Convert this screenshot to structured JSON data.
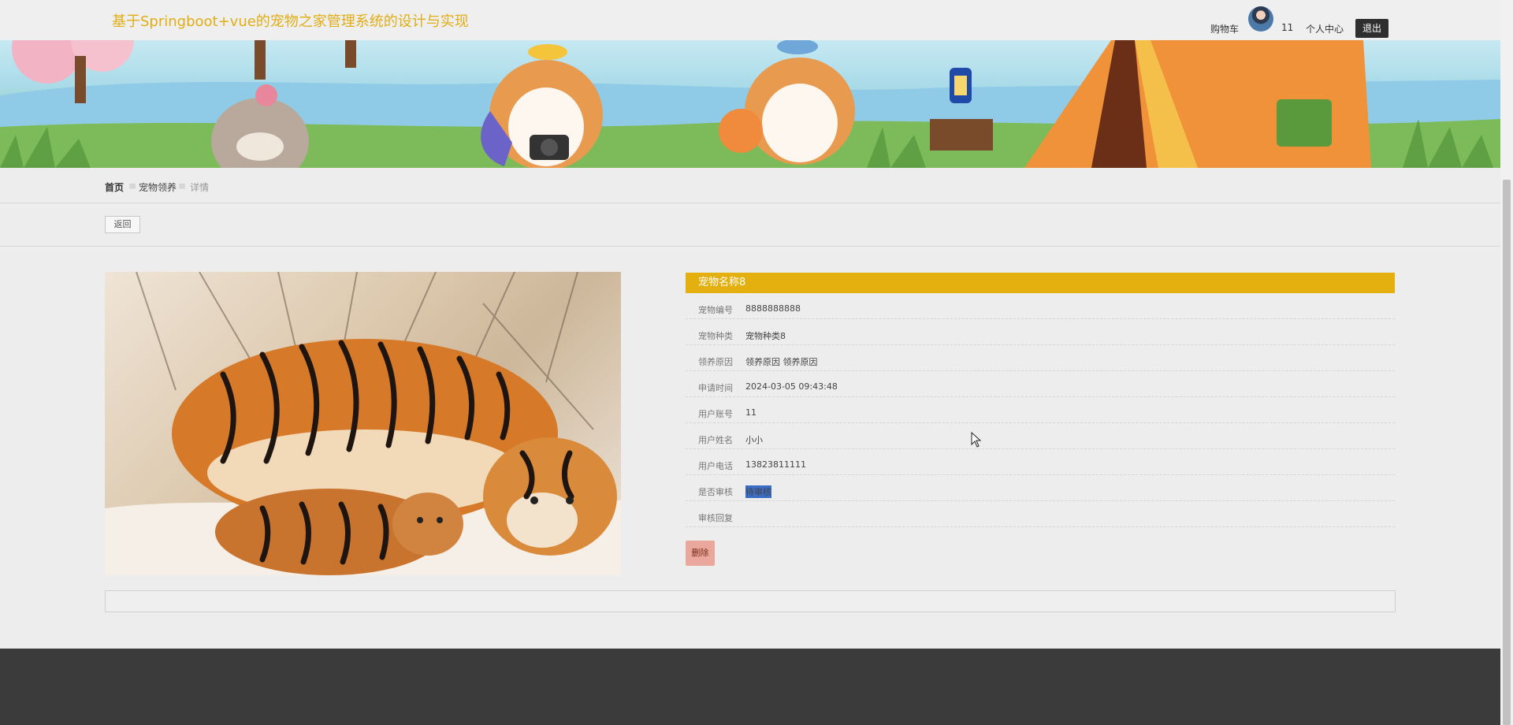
{
  "header": {
    "title": "基于Springboot+vue的宠物之家管理系统的设计与实现",
    "cart_label": "购物车",
    "user_account": "11",
    "user_center_label": "个人中心",
    "logout_label": "退出"
  },
  "breadcrumb": {
    "items": [
      "首页",
      "宠物领养",
      "详情"
    ],
    "separator": "≡"
  },
  "back_label": "返回",
  "detail": {
    "title": "宠物名称8",
    "fields": [
      {
        "label": "宠物编号",
        "value": "8888888888"
      },
      {
        "label": "宠物种类",
        "value": "宠物种类8"
      },
      {
        "label": "领养原因",
        "value": "领养原因 领养原因"
      },
      {
        "label": "申请时间",
        "value": "2024-03-05 09:43:48"
      },
      {
        "label": "用户账号",
        "value": "11"
      },
      {
        "label": "用户姓名",
        "value": "小小"
      },
      {
        "label": "用户电话",
        "value": "13823811111"
      },
      {
        "label": "是否审核",
        "value": "待审核"
      },
      {
        "label": "审核回复",
        "value": ""
      }
    ],
    "delete_label": "删除"
  },
  "colors": {
    "accent": "#e3b00f",
    "title_gold": "#e0ad14",
    "footer": "#3b3b3b",
    "delete_bg": "#eaa89c"
  },
  "icons": {
    "avatar": "user-avatar",
    "cursor": "mouse-pointer-icon"
  }
}
